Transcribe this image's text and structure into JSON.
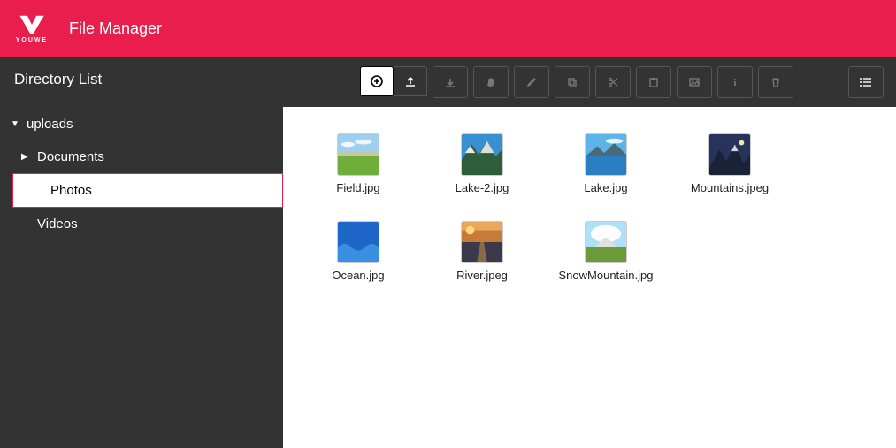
{
  "header": {
    "brand": "YOUWE",
    "app_title": "File Manager"
  },
  "sidebar": {
    "title": "Directory List",
    "root": {
      "label": "uploads",
      "expanded": true,
      "children": [
        {
          "label": "Documents",
          "expanded": false
        },
        {
          "label": "Photos",
          "active": true
        },
        {
          "label": "Videos"
        }
      ]
    }
  },
  "toolbar": {
    "buttons": {
      "add": "add-icon",
      "upload": "upload-icon",
      "download": "download-icon",
      "move": "hand-icon",
      "edit": "pencil-icon",
      "copy": "copy-icon",
      "cut": "scissors-icon",
      "paste": "paste-icon",
      "image": "image-icon",
      "info": "info-icon",
      "delete": "trash-icon",
      "view": "list-view-icon"
    }
  },
  "files": [
    {
      "name": "Field.jpg",
      "thumb": "field"
    },
    {
      "name": "Lake-2.jpg",
      "thumb": "lake2"
    },
    {
      "name": "Lake.jpg",
      "thumb": "lake"
    },
    {
      "name": "Mountains.jpeg",
      "thumb": "mountains"
    },
    {
      "name": "Ocean.jpg",
      "thumb": "ocean"
    },
    {
      "name": "River.jpeg",
      "thumb": "river"
    },
    {
      "name": "SnowMountain.jpg",
      "thumb": "snowmountain"
    }
  ]
}
